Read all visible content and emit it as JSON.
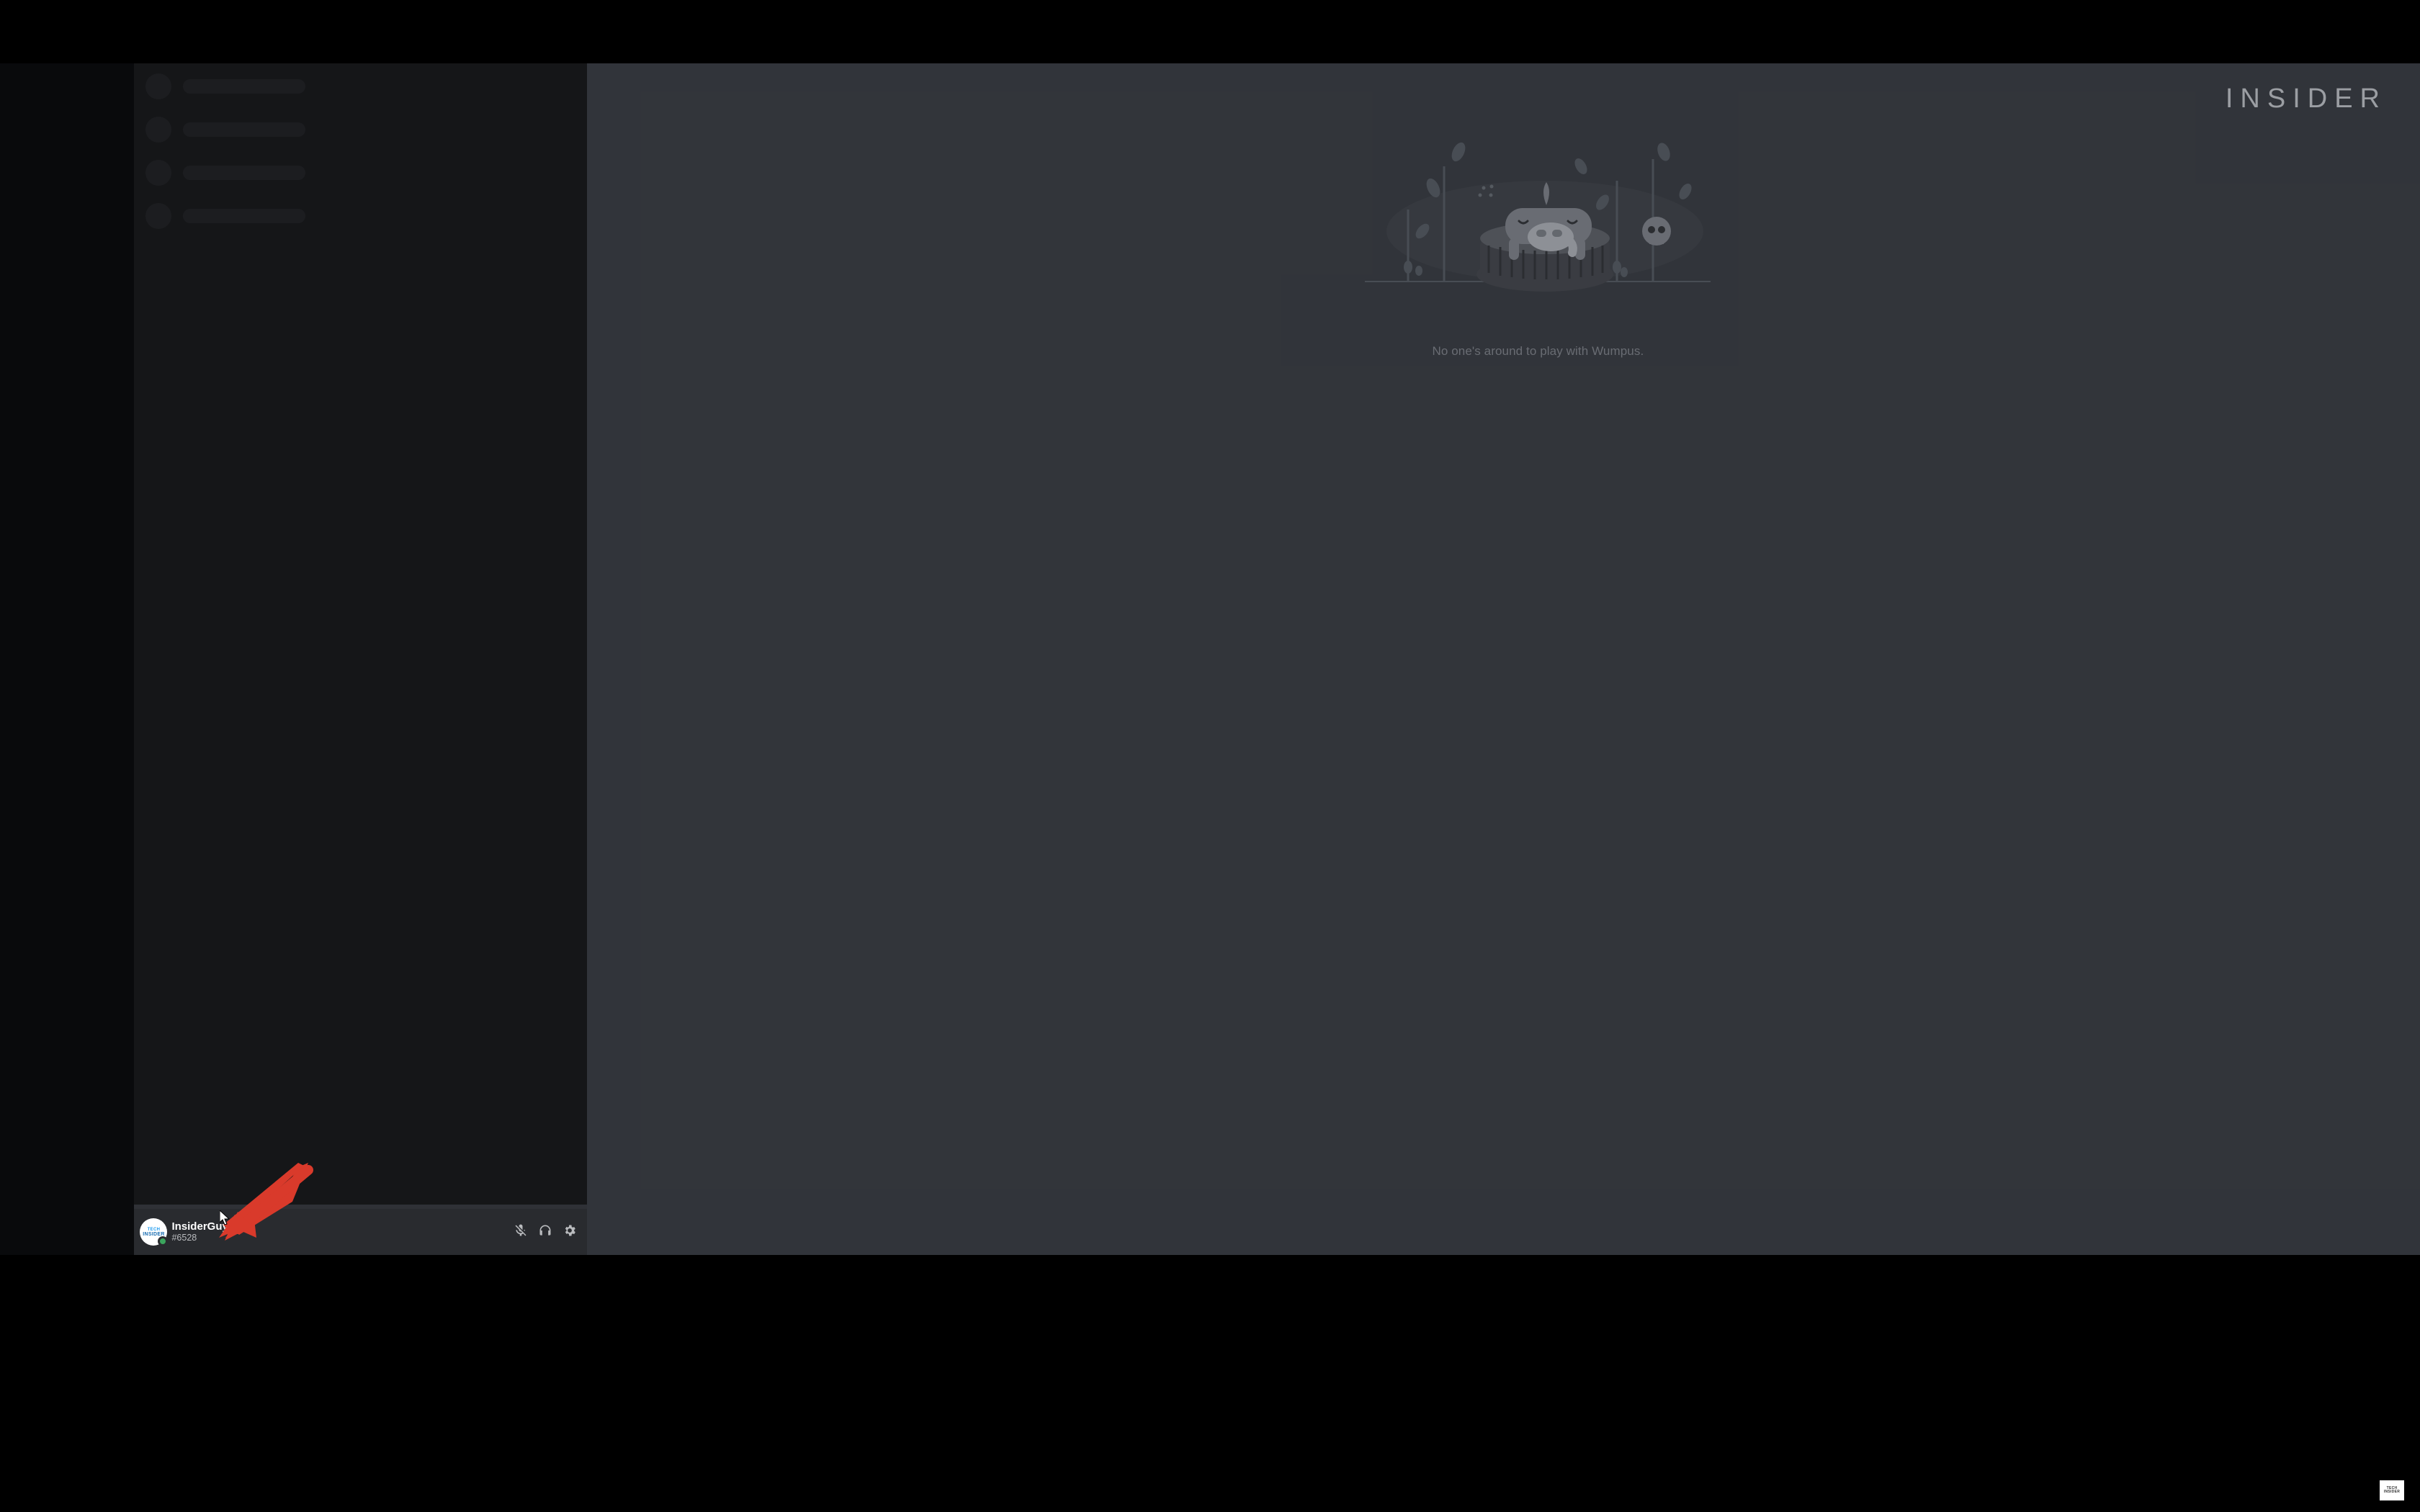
{
  "watermark": {
    "logo_text": "INSIDER",
    "mini_text": "TECH INSIDER"
  },
  "main": {
    "empty_caption": "No one's around to play with Wumpus."
  },
  "user_panel": {
    "username": "InsiderGuy2...",
    "discriminator": "#6528",
    "avatar_label_top": "TECH",
    "avatar_label_bottom": "INSIDER",
    "status": "online",
    "buttons": {
      "mic": "mic-muted-icon",
      "headphones": "headphones-icon",
      "settings": "gear-icon"
    }
  },
  "colors": {
    "bg_main": "#36393f",
    "bg_sidebar": "#2f3136",
    "bg_guilds": "#202225",
    "bg_panel": "#292b2f",
    "text_muted": "#72767d",
    "status_online": "#3ba55d",
    "annotate_red": "#d93a2b"
  }
}
